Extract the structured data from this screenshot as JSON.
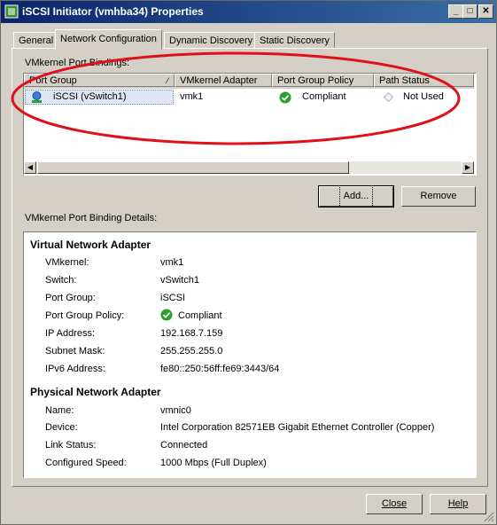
{
  "window": {
    "title": "iSCSI Initiator (vmhba34) Properties",
    "minimize": "_",
    "maximize": "□",
    "close": "✕"
  },
  "tabs": [
    {
      "label": "General"
    },
    {
      "label": "Network Configuration"
    },
    {
      "label": "Dynamic Discovery"
    },
    {
      "label": "Static Discovery"
    }
  ],
  "bindings": {
    "group_label": "VMkernel Port Bindings:",
    "columns": [
      "Port Group",
      "VMkernel Adapter",
      "Port Group Policy",
      "Path Status"
    ],
    "rows": [
      {
        "port_group": "iSCSI (vSwitch1)",
        "adapter": "vmk1",
        "policy": "Compliant",
        "path_status": "Not Used"
      }
    ]
  },
  "buttons": {
    "add": "Add...",
    "remove": "Remove",
    "close": "Close",
    "help": "Help"
  },
  "details": {
    "label": "VMkernel Port Binding Details:",
    "virtual": {
      "title": "Virtual Network Adapter",
      "items": [
        {
          "k": "VMkernel:",
          "v": "vmk1"
        },
        {
          "k": "Switch:",
          "v": "vSwitch1"
        },
        {
          "k": "Port Group:",
          "v": "iSCSI"
        },
        {
          "k": "Port Group Policy:",
          "v": "Compliant"
        },
        {
          "k": "IP Address:",
          "v": "192.168.7.159"
        },
        {
          "k": "Subnet Mask:",
          "v": "255.255.255.0"
        },
        {
          "k": "IPv6 Address:",
          "v": "fe80::250:56ff:fe69:3443/64"
        }
      ]
    },
    "physical": {
      "title": "Physical Network Adapter",
      "items": [
        {
          "k": "Name:",
          "v": "vmnic0"
        },
        {
          "k": "Device:",
          "v": "Intel Corporation 82571EB Gigabit Ethernet Controller (Copper)"
        },
        {
          "k": "Link Status:",
          "v": "Connected"
        },
        {
          "k": "Configured Speed:",
          "v": "1000 Mbps (Full Duplex)"
        }
      ]
    }
  },
  "colors": {
    "titlebar": "#0a246a",
    "annotation": "#e0101a",
    "compliant": "#2aa12a"
  }
}
